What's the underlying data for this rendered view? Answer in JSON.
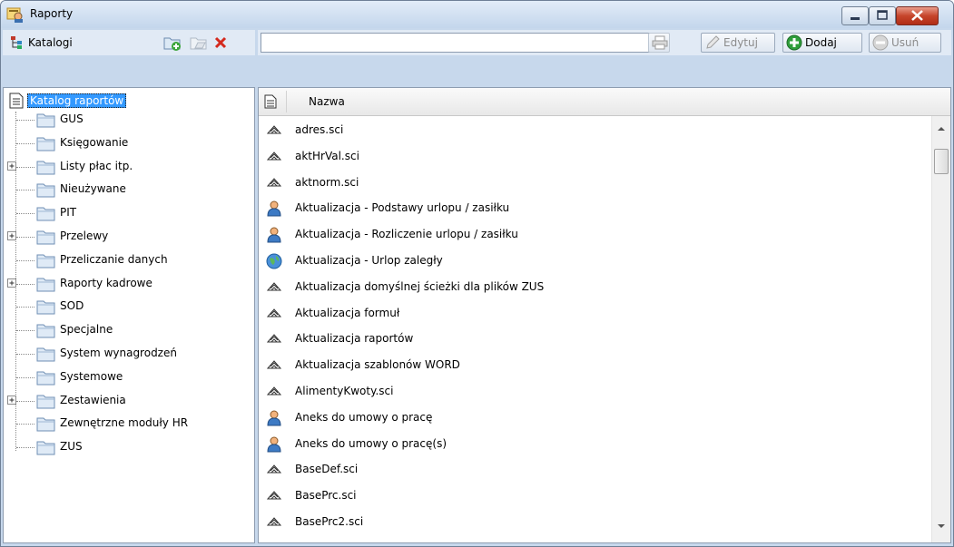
{
  "window": {
    "title": "Raporty",
    "app_icon": "report-icon"
  },
  "caption_buttons": [
    "minimize-icon",
    "maximize-icon",
    "close-icon"
  ],
  "left_toolbar": {
    "label": "Katalogi",
    "label_icon": "tree-icon",
    "buttons": [
      "add-folder-icon",
      "folder-disabled-icon",
      "delete-icon"
    ]
  },
  "right_toolbar": {
    "search_value": "",
    "print_icon": "printer-icon",
    "edit_label": "Edytuj",
    "add_label": "Dodaj",
    "delete_label": "Usuń"
  },
  "tree": {
    "root": "Katalog raportów",
    "items": [
      {
        "label": "GUS",
        "expandable": false
      },
      {
        "label": "Księgowanie",
        "expandable": false
      },
      {
        "label": "Listy płac itp.",
        "expandable": true
      },
      {
        "label": "Nieużywane",
        "expandable": false
      },
      {
        "label": "PIT",
        "expandable": false
      },
      {
        "label": "Przelewy",
        "expandable": true
      },
      {
        "label": "Przeliczanie danych",
        "expandable": false
      },
      {
        "label": "Raporty kadrowe",
        "expandable": true
      },
      {
        "label": "SOD",
        "expandable": false
      },
      {
        "label": "Specjalne",
        "expandable": false
      },
      {
        "label": "System wynagrodzeń",
        "expandable": false
      },
      {
        "label": "Systemowe",
        "expandable": false
      },
      {
        "label": "Zestawienia",
        "expandable": true
      },
      {
        "label": "Zewnętrzne moduły HR",
        "expandable": false
      },
      {
        "label": "ZUS",
        "expandable": false
      }
    ]
  },
  "list": {
    "column_header": "Nazwa",
    "rows": [
      {
        "name": "adres.sci",
        "icon": "script-icon"
      },
      {
        "name": "aktHrVal.sci",
        "icon": "script-icon"
      },
      {
        "name": "aktnorm.sci",
        "icon": "script-icon"
      },
      {
        "name": "Aktualizacja - Podstawy urlopu / zasiłku",
        "icon": "person-icon"
      },
      {
        "name": "Aktualizacja - Rozliczenie urlopu / zasiłku",
        "icon": "person-icon"
      },
      {
        "name": "Aktualizacja - Urlop zaległy",
        "icon": "globe-icon"
      },
      {
        "name": "Aktualizacja domyślnej ścieżki dla plików ZUS",
        "icon": "script-icon"
      },
      {
        "name": "Aktualizacja formuł",
        "icon": "script-icon"
      },
      {
        "name": "Aktualizacja raportów",
        "icon": "script-icon"
      },
      {
        "name": "Aktualizacja szablonów WORD",
        "icon": "script-icon"
      },
      {
        "name": "AlimentyKwoty.sci",
        "icon": "script-icon"
      },
      {
        "name": "Aneks do umowy o pracę",
        "icon": "person-icon"
      },
      {
        "name": "Aneks do umowy o pracę(s)",
        "icon": "person-icon"
      },
      {
        "name": "BaseDef.sci",
        "icon": "script-icon"
      },
      {
        "name": "BasePrc.sci",
        "icon": "script-icon"
      },
      {
        "name": "BasePrc2.sci",
        "icon": "script-icon"
      }
    ]
  }
}
